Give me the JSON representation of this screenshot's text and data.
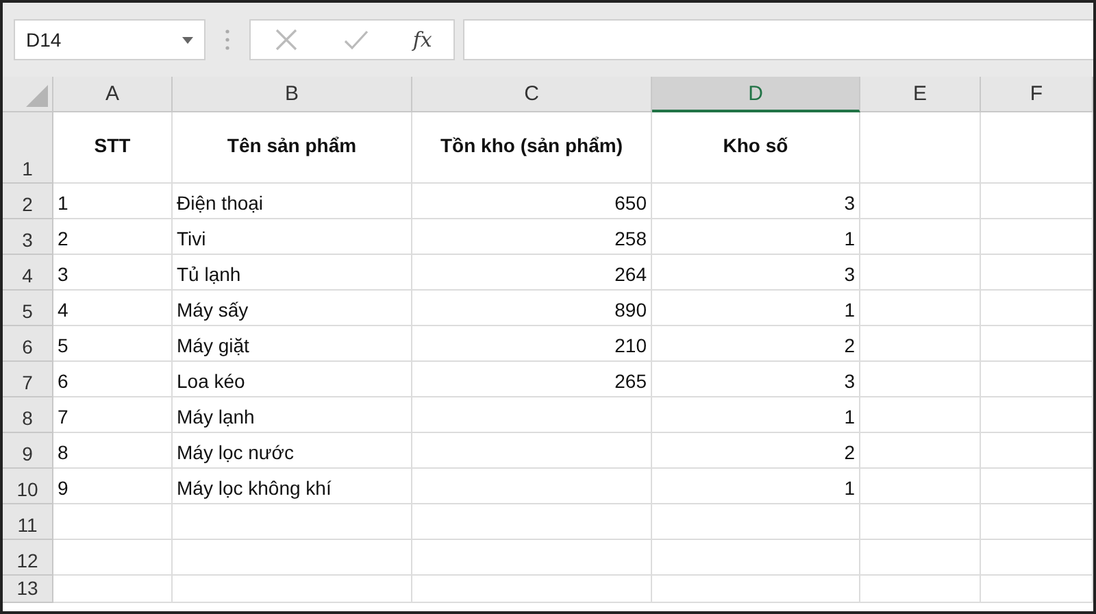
{
  "name_box": {
    "value": "D14"
  },
  "formula_bar": {
    "function_label": "fx"
  },
  "columns": [
    {
      "label": "A",
      "selected": false
    },
    {
      "label": "B",
      "selected": false
    },
    {
      "label": "C",
      "selected": false
    },
    {
      "label": "D",
      "selected": true
    },
    {
      "label": "E",
      "selected": false
    },
    {
      "label": "F",
      "selected": false
    }
  ],
  "rows": [
    {
      "number": "1",
      "kind": "header",
      "cells": {
        "A": "STT",
        "B": "Tên sản phẩm",
        "C": "Tồn kho (sản phẩm)",
        "D": "Kho số"
      }
    },
    {
      "number": "2",
      "kind": "data",
      "cells": {
        "A": "1",
        "B": "Điện thoại",
        "C": "650",
        "D": "3"
      }
    },
    {
      "number": "3",
      "kind": "data",
      "cells": {
        "A": "2",
        "B": "Tivi",
        "C": "258",
        "D": "1"
      }
    },
    {
      "number": "4",
      "kind": "data",
      "cells": {
        "A": "3",
        "B": "Tủ lạnh",
        "C": "264",
        "D": "3"
      }
    },
    {
      "number": "5",
      "kind": "data",
      "cells": {
        "A": "4",
        "B": "Máy sấy",
        "C": "890",
        "D": "1"
      }
    },
    {
      "number": "6",
      "kind": "data",
      "cells": {
        "A": "5",
        "B": "Máy giặt",
        "C": "210",
        "D": "2"
      }
    },
    {
      "number": "7",
      "kind": "data",
      "cells": {
        "A": "6",
        "B": "Loa kéo",
        "C": "265",
        "D": "3"
      }
    },
    {
      "number": "8",
      "kind": "data",
      "cells": {
        "A": "7",
        "B": "Máy lạnh",
        "D": "1"
      }
    },
    {
      "number": "9",
      "kind": "data",
      "cells": {
        "A": "8",
        "B": "Máy lọc nước",
        "D": "2"
      }
    },
    {
      "number": "10",
      "kind": "data",
      "cells": {
        "A": "9",
        "B": "Máy lọc không khí",
        "D": "1"
      }
    },
    {
      "number": "11",
      "kind": "data",
      "cells": {}
    },
    {
      "number": "12",
      "kind": "data",
      "cells": {}
    },
    {
      "number": "13",
      "kind": "data",
      "cells": {}
    }
  ]
}
